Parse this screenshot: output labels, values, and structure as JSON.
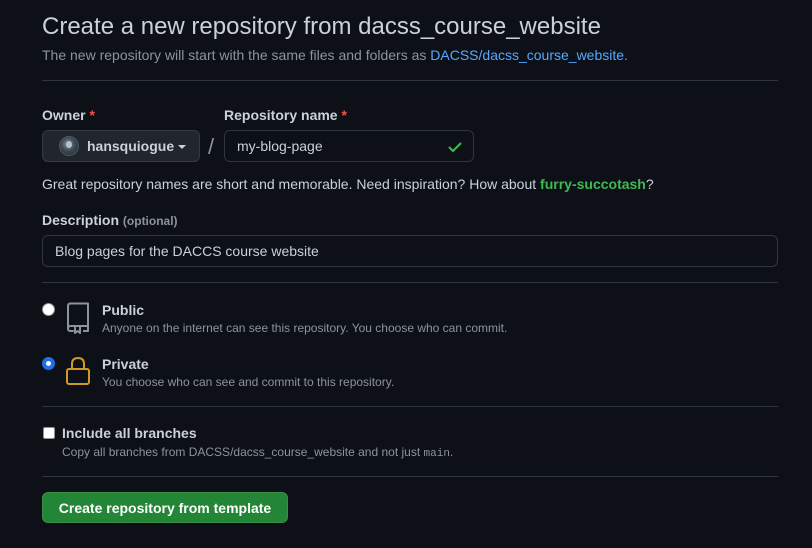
{
  "header": {
    "title": "Create a new repository from dacss_course_website",
    "subtitle_prefix": "The new repository will start with the same files and folders as ",
    "subtitle_link": "DACSS/dacss_course_website",
    "subtitle_suffix": "."
  },
  "owner": {
    "label": "Owner",
    "required_mark": "*",
    "value": "hansquiogue"
  },
  "separator": "/",
  "repo_name": {
    "label": "Repository name",
    "required_mark": "*",
    "value": "my-blog-page",
    "valid_icon": "check-icon"
  },
  "hint": {
    "text": "Great repository names are short and memorable. Need inspiration? How about ",
    "suggestion": "furry-succotash",
    "suffix": "?"
  },
  "description": {
    "label": "Description",
    "optional": "(optional)",
    "value": "Blog pages for the DACCS course website"
  },
  "visibility": {
    "options": [
      {
        "title": "Public",
        "desc": "Anyone on the internet can see this repository. You choose who can commit.",
        "icon": "repo-icon",
        "selected": false
      },
      {
        "title": "Private",
        "desc": "You choose who can see and commit to this repository.",
        "icon": "lock-icon",
        "selected": true
      }
    ]
  },
  "branches": {
    "title": "Include all branches",
    "desc_prefix": "Copy all branches from DACSS/dacss_course_website and not just ",
    "desc_code": "main",
    "desc_suffix": ".",
    "checked": false
  },
  "submit": {
    "label": "Create repository from template"
  },
  "colors": {
    "background": "#0d1117",
    "link": "#58a6ff",
    "success": "#3fb950",
    "primary_button": "#238636",
    "radio_selected": "#1f6feb",
    "lock_icon": "#d29922",
    "required": "#f85149"
  }
}
